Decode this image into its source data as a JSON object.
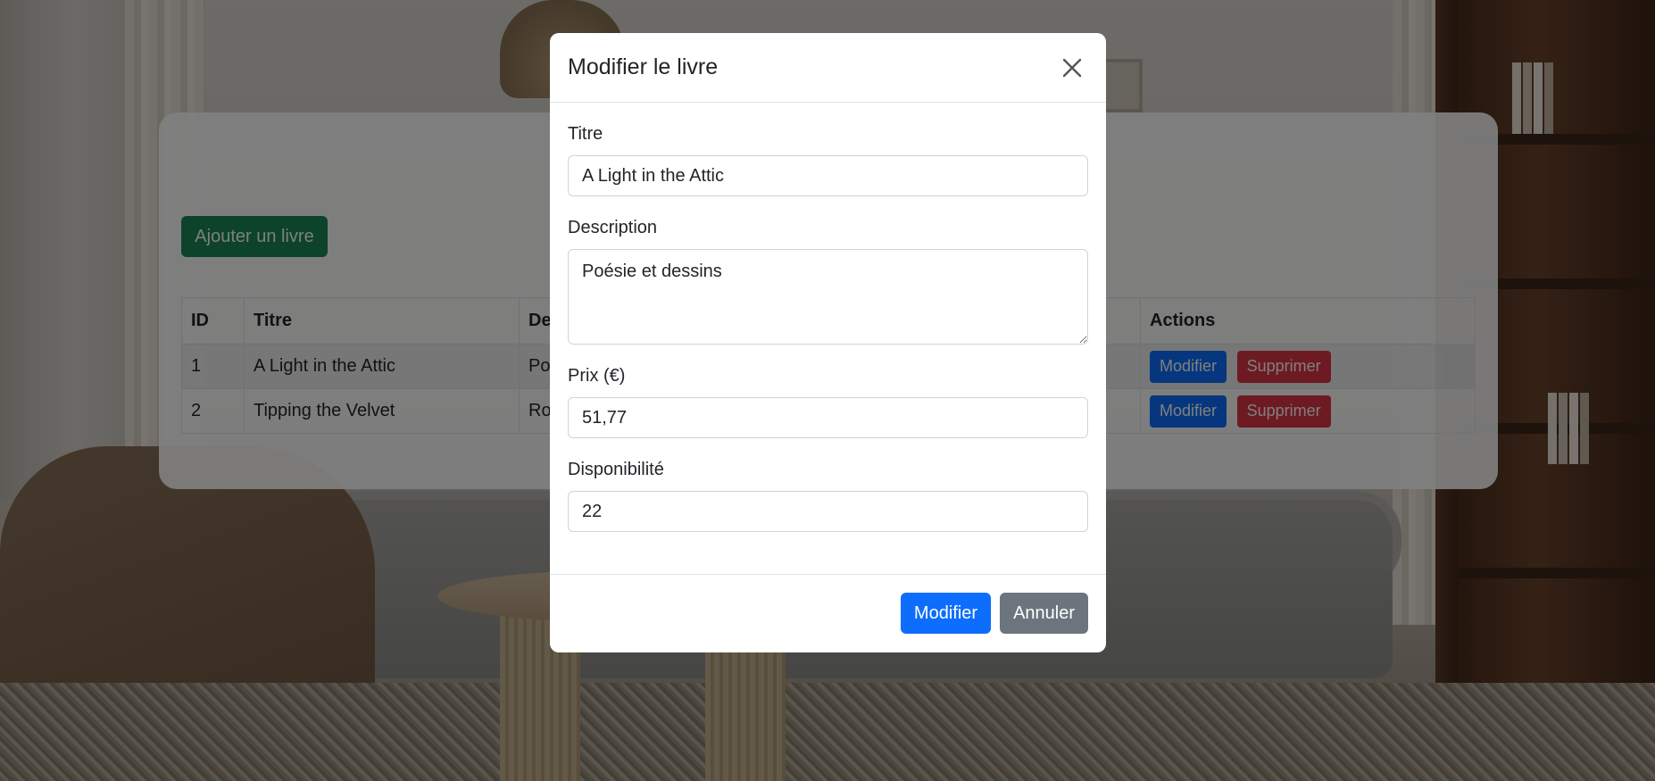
{
  "page": {
    "add_button_label": "Ajouter un livre",
    "table": {
      "headers": {
        "id": "ID",
        "title": "Titre",
        "description": "De",
        "actions": "Actions"
      },
      "rows": [
        {
          "id": "1",
          "title": "A Light in the Attic",
          "description": "Po",
          "edit": "Modifier",
          "delete": "Supprimer"
        },
        {
          "id": "2",
          "title": "Tipping the Velvet",
          "description": "Ro",
          "edit": "Modifier",
          "delete": "Supprimer"
        }
      ]
    }
  },
  "modal": {
    "title": "Modifier le livre",
    "close_icon": "close-icon",
    "fields": {
      "title": {
        "label": "Titre",
        "value": "A Light in the Attic"
      },
      "description": {
        "label": "Description",
        "value": "Poésie et dessins"
      },
      "price": {
        "label": "Prix (€)",
        "value": "51,77"
      },
      "availability": {
        "label": "Disponibilité",
        "value": "22"
      }
    },
    "submit_label": "Modifier",
    "cancel_label": "Annuler"
  },
  "colors": {
    "primary": "#0d6efd",
    "success": "#198754",
    "danger": "#dc3545",
    "secondary": "#6c757d"
  }
}
